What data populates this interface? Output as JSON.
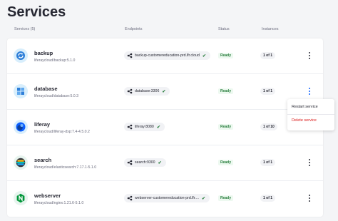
{
  "page": {
    "title": "Services"
  },
  "table": {
    "headers": {
      "services": "Services (5)",
      "endpoints": "Endpoints",
      "status": "Status",
      "instances": "Instances"
    },
    "rows": [
      {
        "name": "backup",
        "image": "liferaycloud/backup:5.1.0",
        "endpoint": "backup-customereducation-prd.lfr.cloud",
        "status": "Ready",
        "instances": "1 of 1",
        "icon": "backup-icon",
        "icon_bg": "#d8eefc"
      },
      {
        "name": "database",
        "image": "liferaycloud/database:5.0.3",
        "endpoint": "database:3306",
        "status": "Ready",
        "instances": "1 of 1",
        "icon": "database-icon",
        "icon_bg": "#d8eefc"
      },
      {
        "name": "liferay",
        "image": "liferaycloud/liferay-dxp:7.4-4.5.0.2",
        "endpoint": "liferay:8080",
        "status": "Ready",
        "instances": "1 of 10",
        "icon": "liferay-icon",
        "icon_bg": "#d8eefc"
      },
      {
        "name": "search",
        "image": "liferaycloud/elasticsearch:7.17.1-5.1.0",
        "endpoint": "search:9300",
        "status": "Ready",
        "instances": "1 of 1",
        "icon": "elasticsearch-icon",
        "icon_bg": "#e7f4ee"
      },
      {
        "name": "webserver",
        "image": "liferaycloud/nginx:1.21.6-5.1.0",
        "endpoint": "webserver-customereducation-prd.lfr....",
        "status": "Ready",
        "instances": "1 of 1",
        "icon": "nginx-icon",
        "icon_bg": "#e7f4ee"
      }
    ]
  },
  "menu": {
    "restart_label": "Restart service",
    "delete_label": "Delete service"
  },
  "colors": {
    "ready_text": "#287d3c",
    "ready_bg": "#edf9f0",
    "delete_text": "#da1414",
    "accent": "#0b5fff"
  }
}
